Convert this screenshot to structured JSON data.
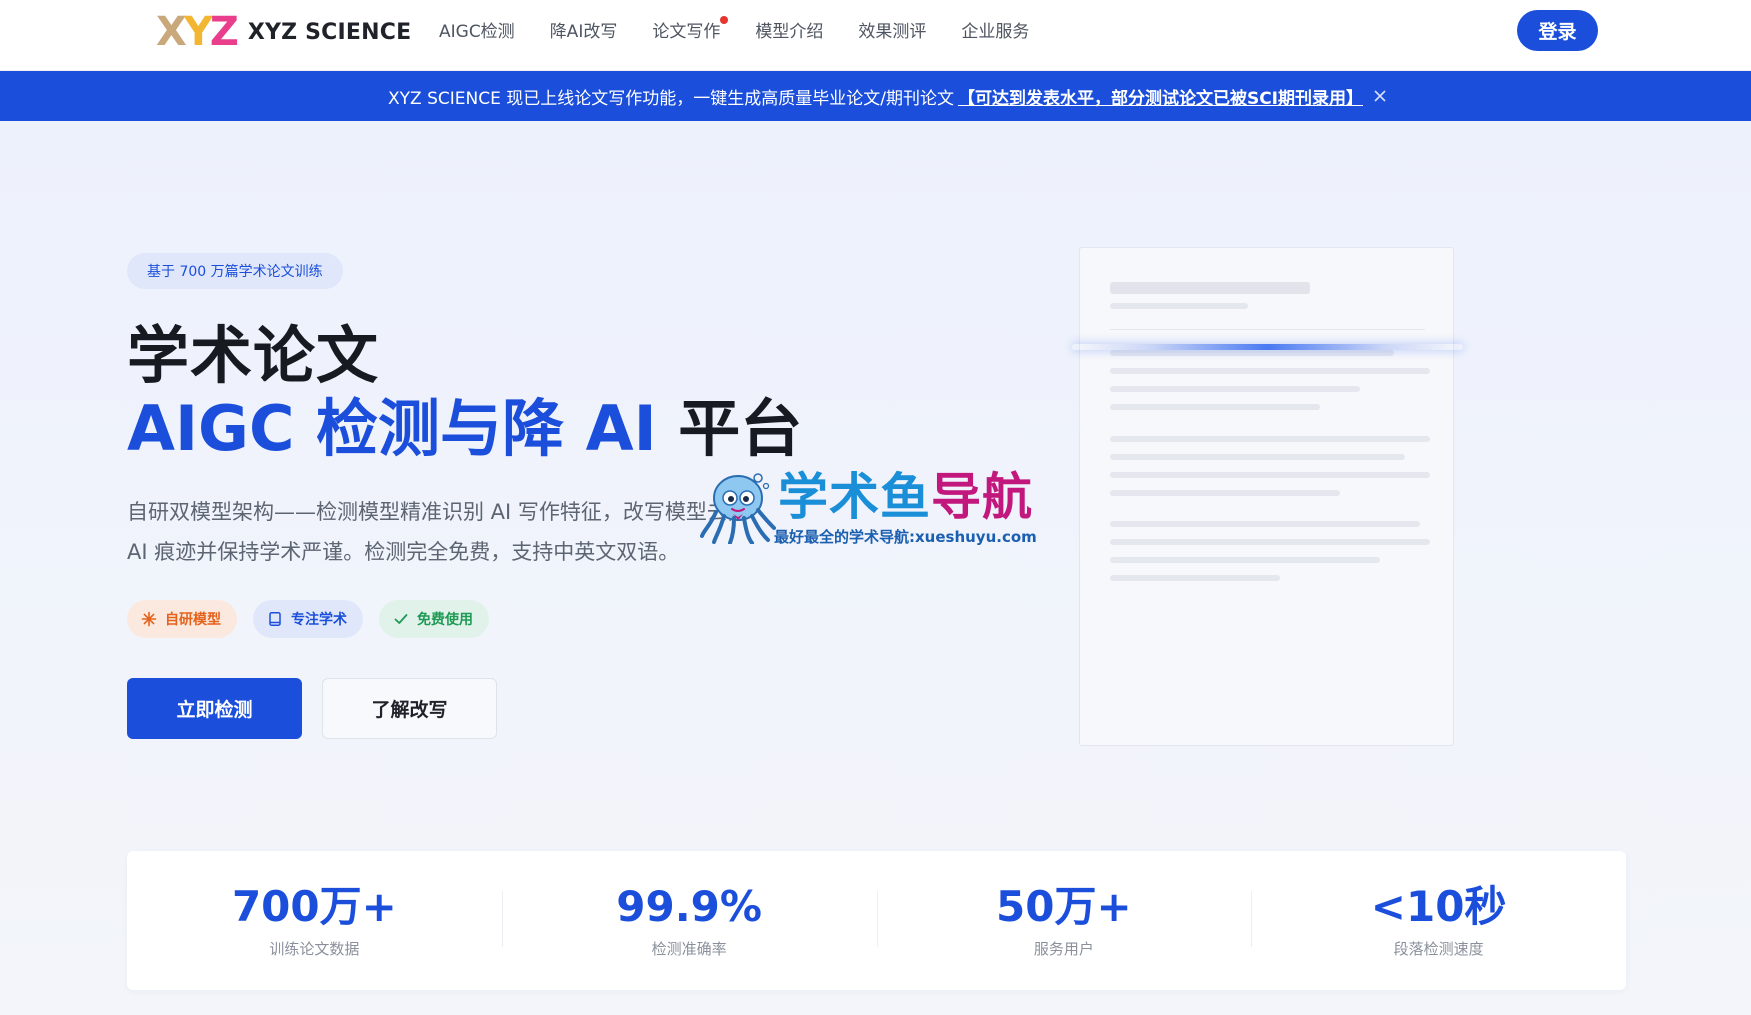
{
  "brand": {
    "logo_text": "XYZ SCIENCE",
    "logo_mark": {
      "x": "X",
      "y": "Y",
      "z": "Z"
    }
  },
  "nav": {
    "items": [
      {
        "label": "AIGC检测",
        "has_dot": false
      },
      {
        "label": "降AI改写",
        "has_dot": false
      },
      {
        "label": "论文写作",
        "has_dot": true
      },
      {
        "label": "模型介绍",
        "has_dot": false
      },
      {
        "label": "效果测评",
        "has_dot": false
      },
      {
        "label": "企业服务",
        "has_dot": false
      }
    ],
    "login_label": "登录"
  },
  "announcement": {
    "text": "XYZ SCIENCE 现已上线论文写作功能，一键生成高质量毕业论文/期刊论文",
    "link_text": "【可达到发表水平，部分测试论文已被SCI期刊录用】"
  },
  "hero": {
    "badge": "基于 700 万篇学术论文训练",
    "title_line1": "学术论文",
    "title_line2_highlight": "AIGC 检测与降 AI",
    "title_line2_rest": " 平台",
    "description": "自研双模型架构——检测模型精准识别 AI 写作特征，改写模型去除 AI 痕迹并保持学术严谨。检测完全免费，支持中英文双语。",
    "tags": [
      {
        "label": "自研模型",
        "icon": "sparkle-icon",
        "color": "#e3621c"
      },
      {
        "label": "专注学术",
        "icon": "book-icon",
        "color": "#1b4fdb"
      },
      {
        "label": "免费使用",
        "icon": "check-icon",
        "color": "#1f9a55"
      }
    ],
    "primary_button": "立即检测",
    "secondary_button": "了解改写"
  },
  "watermark": {
    "title_part1": "学术鱼",
    "title_part2": "导航",
    "subtitle": "最好最全的学术导航:xueshuyu.com"
  },
  "stats": [
    {
      "value": "700万+",
      "label": "训练论文数据"
    },
    {
      "value": "99.9%",
      "label": "检测准确率"
    },
    {
      "value": "50万+",
      "label": "服务用户"
    },
    {
      "value": "<10秒",
      "label": "段落检测速度"
    }
  ],
  "colors": {
    "primary": "#1b4fdb",
    "text": "#171a21",
    "muted": "#5d6472",
    "hero_bg": "#edf1fc"
  }
}
